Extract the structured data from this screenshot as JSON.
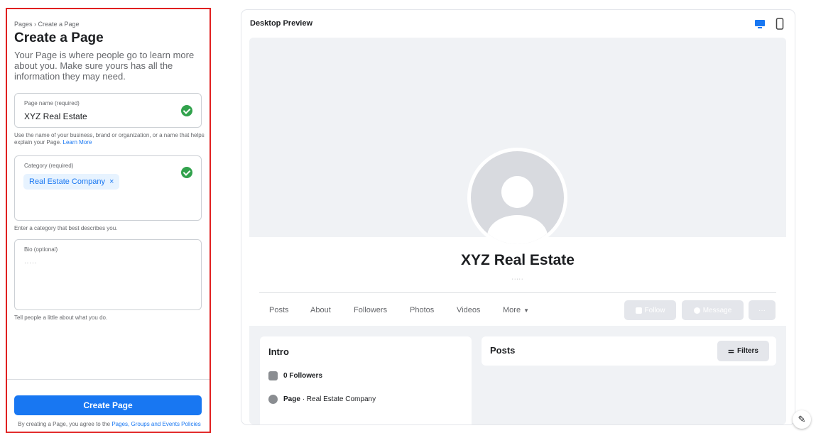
{
  "left": {
    "breadcrumb": "Pages › Create a Page",
    "title": "Create a Page",
    "intro": "Your Page is where people go to learn more about you. Make sure yours has all the information they may need.",
    "page_name": {
      "label": "Page name (required)",
      "value": "XYZ Real Estate",
      "hint": "Use the name of your business, brand or organization, or a name that helps explain your Page.",
      "learn_more": "Learn More"
    },
    "category": {
      "label": "Category (required)",
      "chip": "Real Estate Company",
      "chip_remove": "×",
      "hint": "Enter a category that best describes you."
    },
    "bio": {
      "label": "Bio (optional)",
      "value": "·····",
      "hint": "Tell people a little about what you do."
    },
    "create_button": "Create Page",
    "terms_prefix": "By creating a Page, you agree to the",
    "terms_link": "Pages, Groups and Events Policies"
  },
  "preview": {
    "title": "Desktop Preview",
    "page_name": "XYZ Real Estate",
    "page_sub": "·····",
    "tabs": [
      "Posts",
      "About",
      "Followers",
      "Photos",
      "Videos",
      "More"
    ],
    "more_caret": "▼",
    "follow": "Follow",
    "message": "Message",
    "more_actions": "···",
    "intro_title": "Intro",
    "followers": "0 Followers",
    "page_label": "Page",
    "page_category": "· Real Estate Company",
    "posts_title": "Posts",
    "filters": "Filters",
    "filters_glyph": "⚌"
  },
  "colors": {
    "accent": "#1877f2",
    "success": "#31a24c",
    "highlight_border": "#e02020"
  },
  "icons": {
    "compose": "✎"
  }
}
